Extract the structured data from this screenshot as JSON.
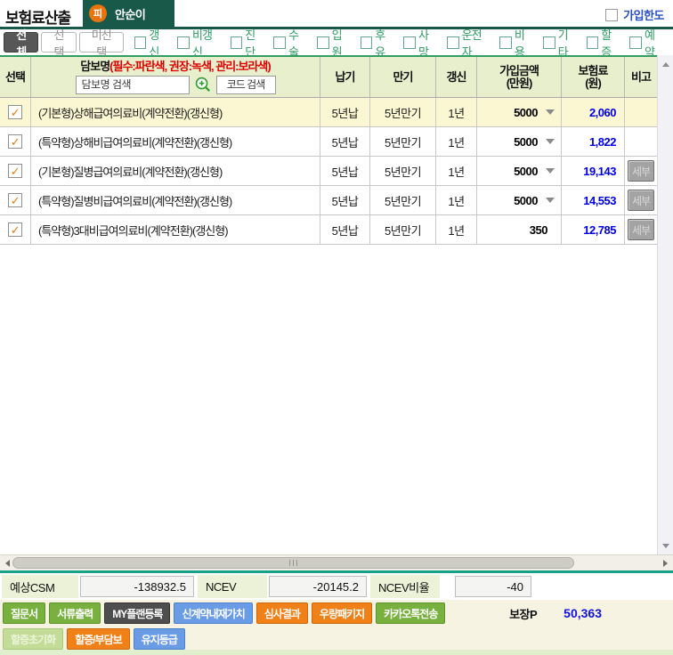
{
  "title": "보험료산출",
  "tab": {
    "badge": "피",
    "name": "안순이"
  },
  "top_right": {
    "join_limit": "가입한도"
  },
  "filter": {
    "all": "전체",
    "selected": "선택",
    "unselected": "미선택",
    "categories": [
      "갱신",
      "비갱신",
      "진단",
      "수술",
      "입원",
      "후유",
      "사망",
      "운전자",
      "비용",
      "기타",
      "할증",
      "예약"
    ]
  },
  "table": {
    "col_select": "선택",
    "col_coverage": "담보명",
    "col_coverage_note": "(필수:파란색, 권장:녹색, 관리:보라색)",
    "search_placeholder": "담보명 검색",
    "code_placeholder": "코드 검색",
    "col_payment": "납기",
    "col_maturity": "만기",
    "col_renewal": "갱신",
    "col_amount_1": "가입금액",
    "col_amount_2": "(만원)",
    "col_premium_1": "보험료",
    "col_premium_2": "(원)",
    "col_note": "비고",
    "detail_label": "세부",
    "check_glyph": "✓",
    "rows": [
      {
        "coverage": "(기본형)상해급여의료비(계약전환)(갱신형)",
        "payment": "5년납",
        "maturity": "5년만기",
        "renewal": "1년",
        "amount": "5000",
        "premium": "2,060"
      },
      {
        "coverage": "(특약형)상해비급여의료비(계약전환)(갱신형)",
        "payment": "5년납",
        "maturity": "5년만기",
        "renewal": "1년",
        "amount": "5000",
        "premium": "1,822"
      },
      {
        "coverage": "(기본형)질병급여의료비(계약전환)(갱신형)",
        "payment": "5년납",
        "maturity": "5년만기",
        "renewal": "1년",
        "amount": "5000",
        "premium": "19,143"
      },
      {
        "coverage": "(특약형)질병비급여의료비(계약전환)(갱신형)",
        "payment": "5년납",
        "maturity": "5년만기",
        "renewal": "1년",
        "amount": "5000",
        "premium": "14,553"
      },
      {
        "coverage": "(특약형)3대비급여의료비(계약전환)(갱신형)",
        "payment": "5년납",
        "maturity": "5년만기",
        "renewal": "1년",
        "amount": "350",
        "premium": "12,785"
      }
    ]
  },
  "stats": {
    "csm_label": "예상CSM",
    "csm_value": "-138932.5",
    "ncev_label": "NCEV",
    "ncev_value": "-20145.2",
    "ncev_ratio_label": "NCEV비율",
    "ncev_ratio_value": "-40"
  },
  "actions": {
    "questionnaire": "질문서",
    "print_docs": "서류출력",
    "my_plan": "MY플랜등록",
    "new_contract_value": "신계약내재가치",
    "review_result": "심사결과",
    "premium_package": "우량패키지",
    "kakao_send": "카카오톡전송",
    "surcharge_reset": "할증초기화",
    "surcharge_exclusion": "할증/부담보",
    "retention_grade": "유지등급",
    "coverage_p_label": "보장P",
    "coverage_p_value": "50,363"
  },
  "colors": {
    "header_green": "#19594a",
    "badge_orange": "#e8740c",
    "link_blue": "#2b50c0",
    "filter_label_green": "#2d9b63",
    "table_header_bg": "#e7efcd",
    "table_top_border_green": "#2f9e60",
    "selected_row_bg": "#fbf7d2",
    "check_orange": "#e8780f",
    "premium_blue": "#0000e6",
    "note_red": "#e00000",
    "divider_teal": "#17a189",
    "button_green": "#79b140",
    "button_blue": "#699ce4",
    "button_orange": "#f08118",
    "button_dark": "#4e4e4e",
    "actions_bg": "#f6f3e2"
  }
}
